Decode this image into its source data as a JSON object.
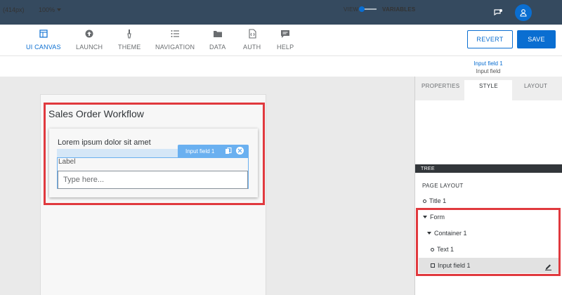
{
  "toolbar": {
    "tools": [
      {
        "label": "UI CANVAS",
        "icon": "ui-canvas-icon"
      },
      {
        "label": "LAUNCH",
        "icon": "launch-icon"
      },
      {
        "label": "THEME",
        "icon": "theme-brush-icon"
      },
      {
        "label": "NAVIGATION",
        "icon": "navigation-list-icon"
      },
      {
        "label": "DATA",
        "icon": "data-folder-icon"
      },
      {
        "label": "AUTH",
        "icon": "auth-code-icon"
      },
      {
        "label": "HELP",
        "icon": "help-chat-icon"
      }
    ],
    "revert_label": "REVERT",
    "save_label": "SAVE"
  },
  "subbar": {
    "device_size": "(414px)",
    "zoom": "100%",
    "view_label": "VIEW",
    "variables_label": "VARIABLES"
  },
  "selection": {
    "title": "Input field 1",
    "subtitle": "Input field"
  },
  "canvas": {
    "page_title": "Sales Order Workflow",
    "text": "Lorem ipsum dolor sit amet",
    "badge_label": "Input field 1",
    "field_label": "Label",
    "field_placeholder": "Type here..."
  },
  "panel": {
    "tabs": [
      "PROPERTIES",
      "STYLE",
      "LAYOUT"
    ],
    "active_tab": "STYLE",
    "tree_header": "TREE",
    "tree": {
      "page_layout": "PAGE LAYOUT",
      "title": "Title 1",
      "form": "Form",
      "container": "Container 1",
      "text": "Text 1",
      "input": "Input field 1"
    }
  },
  "colors": {
    "shell": "#354a5f",
    "accent": "#0a6ed1",
    "highlight": "#e0393e",
    "selection": "#6ab0f0"
  }
}
